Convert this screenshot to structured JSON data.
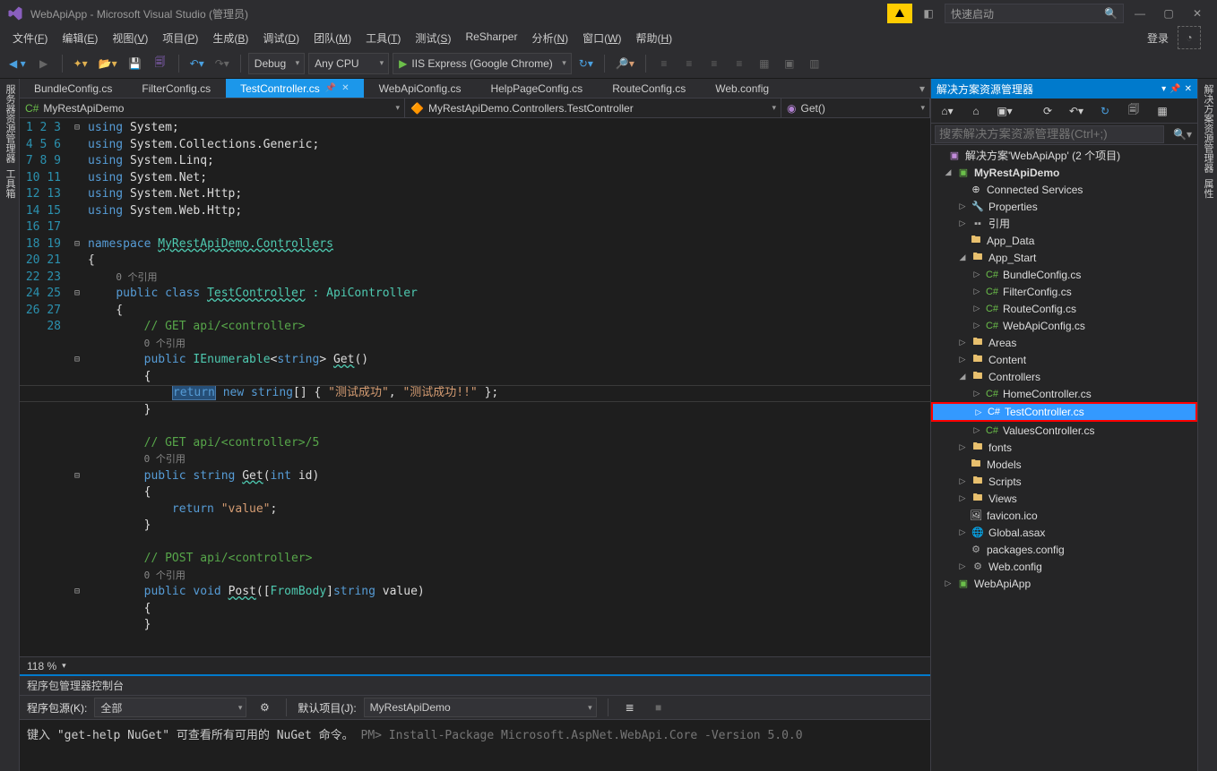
{
  "title": "WebApiApp - Microsoft Visual Studio (管理员)",
  "quicklaunch_placeholder": "快速启动",
  "menubar": [
    "文件(F)",
    "编辑(E)",
    "视图(V)",
    "项目(P)",
    "生成(B)",
    "调试(D)",
    "团队(M)",
    "工具(T)",
    "测试(S)",
    "ReSharper",
    "分析(N)",
    "窗口(W)",
    "帮助(H)"
  ],
  "login_label": "登录",
  "toolbar": {
    "config": "Debug",
    "platform": "Any CPU",
    "run": "IIS Express (Google Chrome)"
  },
  "doctabs": [
    "BundleConfig.cs",
    "FilterConfig.cs",
    "TestController.cs",
    "WebApiConfig.cs",
    "HelpPageConfig.cs",
    "RouteConfig.cs",
    "Web.config"
  ],
  "doctab_active": 2,
  "nav": {
    "left": "MyRestApiDemo",
    "mid": "MyRestApiDemo.Controllers.TestController",
    "right": "Get()"
  },
  "zoom": "118 %",
  "left_tabs": [
    "服务器资源管理器",
    "工具箱"
  ],
  "right_tabs": [
    "解决方案资源管理器",
    "属性"
  ],
  "solution_panel": {
    "title": "解决方案资源管理器",
    "search_placeholder": "搜索解决方案资源管理器(Ctrl+;)"
  },
  "tree": {
    "solution": "解决方案'WebApiApp' (2 个项目)",
    "proj1": "MyRestApiDemo",
    "conn": "Connected Services",
    "props": "Properties",
    "refs": "引用",
    "appdata": "App_Data",
    "appstart": "App_Start",
    "bundle": "BundleConfig.cs",
    "filter": "FilterConfig.cs",
    "route": "RouteConfig.cs",
    "webapi": "WebApiConfig.cs",
    "areas": "Areas",
    "content": "Content",
    "controllers": "Controllers",
    "home": "HomeController.cs",
    "test": "TestController.cs",
    "values": "ValuesController.cs",
    "fonts": "fonts",
    "models": "Models",
    "scripts": "Scripts",
    "views": "Views",
    "favicon": "favicon.ico",
    "global": "Global.asax",
    "packages": "packages.config",
    "webconfig": "Web.config",
    "proj2": "WebApiApp"
  },
  "console": {
    "title": "程序包管理器控制台",
    "src_label": "程序包源(K):",
    "src_val": "全部",
    "proj_label": "默认项目(J):",
    "proj_val": "MyRestApiDemo",
    "line1": "键入 \"get-help NuGet\" 可查看所有可用的 NuGet 命令。",
    "line2": "PM> Install-Package Microsoft.AspNet.WebApi.Core -Version 5.0.0"
  },
  "code": {
    "codelens": "0 个引用",
    "lines": {
      "l1": "using",
      "l1b": "System;",
      "l2": "System.Collections.Generic;",
      "l3": "System.Linq;",
      "l4": "System.Net;",
      "l5": "System.Net.Http;",
      "l6": "System.Web.Http;",
      "ns": "namespace",
      "nsv": "MyRestApiDemo.Controllers",
      "pc": "public class",
      "tc": "TestController",
      "ac": ": ApiController",
      "c1": "// GET api/<controller>",
      "ie": "IEnumerable",
      "str": "string",
      "get": "Get",
      "ret": "return",
      "new": "new",
      "arr1": "\"测试成功\"",
      "arr2": "\"测试成功!!\"",
      "c2": "// GET api/<controller>/5",
      "int": "int",
      "id": "id",
      "val": "\"value\"",
      "c3": "// POST api/<controller>",
      "void": "void",
      "post": "Post",
      "fb": "FromBody",
      "value": "value"
    }
  }
}
